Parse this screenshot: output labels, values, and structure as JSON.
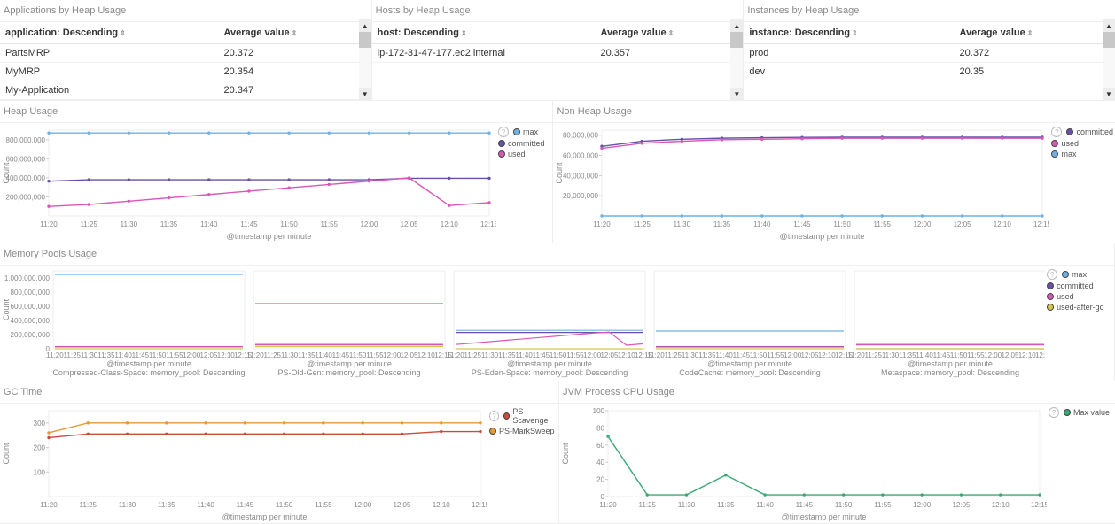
{
  "tables": {
    "apps": {
      "title": "Applications by Heap Usage",
      "col0": "application: Descending",
      "col1": "Average value",
      "rows": [
        {
          "name": "PartsMRP",
          "value": "20.372"
        },
        {
          "name": "MyMRP",
          "value": "20.354"
        },
        {
          "name": "My-Application",
          "value": "20.347"
        }
      ]
    },
    "hosts": {
      "title": "Hosts by Heap Usage",
      "col0": "host: Descending",
      "col1": "Average value",
      "rows": [
        {
          "name": "ip-172-31-47-177.ec2.internal",
          "value": "20.357"
        }
      ]
    },
    "instances": {
      "title": "Instances by Heap Usage",
      "col0": "instance: Descending",
      "col1": "Average value",
      "rows": [
        {
          "name": "prod",
          "value": "20.372"
        },
        {
          "name": "dev",
          "value": "20.35"
        }
      ]
    }
  },
  "charts": {
    "heap": {
      "title": "Heap Usage",
      "xlabel": "@timestamp per minute",
      "ylabel": "Count",
      "legend": [
        "max",
        "committed",
        "used"
      ],
      "colors": [
        "#6fb1e4",
        "#6a4fa8",
        "#d957b6"
      ]
    },
    "nonheap": {
      "title": "Non Heap Usage",
      "xlabel": "@timestamp per minute",
      "ylabel": "Count",
      "legend": [
        "committed",
        "used",
        "max"
      ],
      "colors": [
        "#6a4fa8",
        "#d957b6",
        "#6fb1e4"
      ]
    },
    "mempools": {
      "title": "Memory Pools Usage",
      "xlabel": "@timestamp per minute",
      "ylabel": "Count",
      "legend": [
        "max",
        "committed",
        "used",
        "used-after-gc"
      ],
      "colors": [
        "#6fb1e4",
        "#6a4fa8",
        "#d957b6",
        "#d6c64a"
      ],
      "subs": [
        "Compressed-Class-Space: memory_pool: Descending",
        "PS-Old-Gen: memory_pool: Descending",
        "PS-Eden-Space: memory_pool: Descending",
        "CodeCache: memory_pool: Descending",
        "Metaspace: memory_pool: Descending"
      ]
    },
    "gctime": {
      "title": "GC Time",
      "xlabel": "@timestamp per minute",
      "ylabel": "Count",
      "legend": [
        "PS-Scavenge",
        "PS-MarkSweep"
      ],
      "colors": [
        "#c94d3d",
        "#e49a3a"
      ]
    },
    "cpu": {
      "title": "JVM Process CPU Usage",
      "xlabel": "@timestamp per minute",
      "ylabel": "Count",
      "legend": [
        "Max value"
      ],
      "colors": [
        "#3aa873"
      ]
    },
    "xticks": [
      "11:20",
      "11:25",
      "11:30",
      "11:35",
      "11:40",
      "11:45",
      "11:50",
      "11:55",
      "12:00",
      "12:05",
      "12:10",
      "12:15"
    ]
  },
  "chart_data": [
    {
      "id": "heap",
      "type": "line",
      "title": "Heap Usage",
      "xlabel": "@timestamp per minute",
      "ylabel": "Count",
      "x": [
        "11:20",
        "11:25",
        "11:30",
        "11:35",
        "11:40",
        "11:45",
        "11:50",
        "11:55",
        "12:00",
        "12:05",
        "12:10",
        "12:15"
      ],
      "ylim": [
        0,
        900000000
      ],
      "y_ticks": [
        200000000,
        400000000,
        600000000,
        800000000
      ],
      "series": [
        {
          "name": "max",
          "values": [
            870000000,
            870000000,
            870000000,
            870000000,
            870000000,
            870000000,
            870000000,
            870000000,
            870000000,
            870000000,
            870000000,
            870000000
          ]
        },
        {
          "name": "committed",
          "values": [
            365000000,
            380000000,
            380000000,
            380000000,
            380000000,
            380000000,
            380000000,
            380000000,
            380000000,
            395000000,
            395000000,
            395000000
          ]
        },
        {
          "name": "used",
          "values": [
            100000000,
            120000000,
            155000000,
            190000000,
            225000000,
            260000000,
            295000000,
            330000000,
            365000000,
            400000000,
            110000000,
            140000000
          ]
        }
      ]
    },
    {
      "id": "nonheap",
      "type": "line",
      "title": "Non Heap Usage",
      "xlabel": "@timestamp per minute",
      "ylabel": "Count",
      "x": [
        "11:20",
        "11:25",
        "11:30",
        "11:35",
        "11:40",
        "11:45",
        "11:50",
        "11:55",
        "12:00",
        "12:05",
        "12:10",
        "12:15"
      ],
      "ylim": [
        0,
        85000000
      ],
      "y_ticks": [
        20000000,
        40000000,
        60000000,
        80000000
      ],
      "series": [
        {
          "name": "committed",
          "values": [
            69000000,
            74000000,
            76000000,
            77000000,
            77500000,
            77800000,
            78000000,
            78000000,
            78000000,
            78000000,
            78000000,
            78000000
          ]
        },
        {
          "name": "used",
          "values": [
            67000000,
            72000000,
            74000000,
            75500000,
            76000000,
            76500000,
            77000000,
            77000000,
            77000000,
            77000000,
            77000000,
            77000000
          ]
        },
        {
          "name": "max",
          "values": [
            0,
            0,
            0,
            0,
            0,
            0,
            0,
            0,
            0,
            0,
            0,
            0
          ]
        }
      ]
    },
    {
      "id": "mempools",
      "type": "line",
      "title": "Memory Pools Usage",
      "xlabel": "@timestamp per minute",
      "ylabel": "Count",
      "x": [
        "11:20",
        "11:25",
        "11:30",
        "11:35",
        "11:40",
        "11:45",
        "11:50",
        "11:55",
        "12:00",
        "12:05",
        "12:10",
        "12:15"
      ],
      "ylim": [
        0,
        1100000000
      ],
      "y_ticks": [
        0,
        200000000,
        400000000,
        600000000,
        800000000,
        1000000000
      ],
      "panels": [
        {
          "sub": "Compressed-Class-Space: memory_pool: Descending",
          "series": [
            {
              "name": "max",
              "values": [
                1050000000,
                1050000000,
                1050000000,
                1050000000,
                1050000000,
                1050000000,
                1050000000,
                1050000000,
                1050000000,
                1050000000,
                1050000000,
                1050000000
              ]
            },
            {
              "name": "committed",
              "values": [
                30000000,
                30000000,
                30000000,
                30000000,
                30000000,
                30000000,
                30000000,
                30000000,
                30000000,
                30000000,
                30000000,
                30000000
              ]
            },
            {
              "name": "used",
              "values": [
                28000000,
                28000000,
                28000000,
                28000000,
                28000000,
                28000000,
                28000000,
                28000000,
                28000000,
                28000000,
                28000000,
                28000000
              ]
            },
            {
              "name": "used-after-gc",
              "values": [
                0,
                0,
                0,
                0,
                0,
                0,
                0,
                0,
                0,
                0,
                0,
                0
              ]
            }
          ]
        },
        {
          "sub": "PS-Old-Gen: memory_pool: Descending",
          "series": [
            {
              "name": "max",
              "values": [
                640000000,
                640000000,
                640000000,
                640000000,
                640000000,
                640000000,
                640000000,
                640000000,
                640000000,
                640000000,
                640000000,
                640000000
              ]
            },
            {
              "name": "committed",
              "values": [
                60000000,
                60000000,
                60000000,
                60000000,
                60000000,
                60000000,
                60000000,
                60000000,
                60000000,
                60000000,
                60000000,
                60000000
              ]
            },
            {
              "name": "used",
              "values": [
                55000000,
                55000000,
                55000000,
                55000000,
                55000000,
                55000000,
                55000000,
                55000000,
                55000000,
                55000000,
                55000000,
                55000000
              ]
            },
            {
              "name": "used-after-gc",
              "values": [
                30000000,
                30000000,
                30000000,
                30000000,
                30000000,
                30000000,
                30000000,
                30000000,
                30000000,
                30000000,
                30000000,
                30000000
              ]
            }
          ]
        },
        {
          "sub": "PS-Eden-Space: memory_pool: Descending",
          "series": [
            {
              "name": "max",
              "values": [
                260000000,
                260000000,
                260000000,
                260000000,
                260000000,
                260000000,
                260000000,
                260000000,
                260000000,
                260000000,
                260000000,
                260000000
              ]
            },
            {
              "name": "committed",
              "values": [
                230000000,
                230000000,
                230000000,
                230000000,
                230000000,
                230000000,
                230000000,
                230000000,
                230000000,
                230000000,
                230000000,
                230000000
              ]
            },
            {
              "name": "used",
              "values": [
                60000000,
                80000000,
                100000000,
                120000000,
                140000000,
                160000000,
                180000000,
                200000000,
                220000000,
                235000000,
                50000000,
                70000000
              ]
            },
            {
              "name": "used-after-gc",
              "values": [
                0,
                0,
                0,
                0,
                0,
                0,
                0,
                0,
                0,
                0,
                0,
                0
              ]
            }
          ]
        },
        {
          "sub": "CodeCache: memory_pool: Descending",
          "series": [
            {
              "name": "max",
              "values": [
                250000000,
                250000000,
                250000000,
                250000000,
                250000000,
                250000000,
                250000000,
                250000000,
                250000000,
                250000000,
                250000000,
                250000000
              ]
            },
            {
              "name": "committed",
              "values": [
                30000000,
                30000000,
                30000000,
                30000000,
                30000000,
                30000000,
                30000000,
                30000000,
                30000000,
                30000000,
                30000000,
                30000000
              ]
            },
            {
              "name": "used",
              "values": [
                25000000,
                25000000,
                25000000,
                25000000,
                25000000,
                25000000,
                25000000,
                25000000,
                25000000,
                25000000,
                25000000,
                25000000
              ]
            },
            {
              "name": "used-after-gc",
              "values": [
                0,
                0,
                0,
                0,
                0,
                0,
                0,
                0,
                0,
                0,
                0,
                0
              ]
            }
          ]
        },
        {
          "sub": "Metaspace: memory_pool: Descending",
          "series": [
            {
              "name": "committed",
              "values": [
                60000000,
                60000000,
                60000000,
                60000000,
                60000000,
                60000000,
                60000000,
                60000000,
                60000000,
                60000000,
                60000000,
                60000000
              ]
            },
            {
              "name": "used",
              "values": [
                55000000,
                55000000,
                55000000,
                55000000,
                55000000,
                55000000,
                55000000,
                55000000,
                55000000,
                55000000,
                55000000,
                55000000
              ]
            },
            {
              "name": "max",
              "values": [
                0,
                0,
                0,
                0,
                0,
                0,
                0,
                0,
                0,
                0,
                0,
                0
              ]
            },
            {
              "name": "used-after-gc",
              "values": [
                0,
                0,
                0,
                0,
                0,
                0,
                0,
                0,
                0,
                0,
                0,
                0
              ]
            }
          ]
        }
      ]
    },
    {
      "id": "gctime",
      "type": "line",
      "title": "GC Time",
      "xlabel": "@timestamp per minute",
      "ylabel": "Count",
      "x": [
        "11:20",
        "11:25",
        "11:30",
        "11:35",
        "11:40",
        "11:45",
        "11:50",
        "11:55",
        "12:00",
        "12:05",
        "12:10",
        "12:15"
      ],
      "ylim": [
        0,
        350
      ],
      "y_ticks": [
        100,
        200,
        300
      ],
      "series": [
        {
          "name": "PS-Scavenge",
          "values": [
            240,
            255,
            255,
            255,
            255,
            255,
            255,
            255,
            255,
            255,
            265,
            265
          ]
        },
        {
          "name": "PS-MarkSweep",
          "values": [
            260,
            300,
            300,
            300,
            300,
            300,
            300,
            300,
            300,
            300,
            300,
            300
          ]
        }
      ]
    },
    {
      "id": "cpu",
      "type": "line",
      "title": "JVM Process CPU Usage",
      "xlabel": "@timestamp per minute",
      "ylabel": "Count",
      "x": [
        "11:20",
        "11:25",
        "11:30",
        "11:35",
        "11:40",
        "11:45",
        "11:50",
        "11:55",
        "12:00",
        "12:05",
        "12:10",
        "12:15"
      ],
      "ylim": [
        0,
        100
      ],
      "y_ticks": [
        0,
        20,
        40,
        60,
        80,
        100
      ],
      "series": [
        {
          "name": "Max value",
          "values": [
            70,
            2,
            2,
            25,
            2,
            2,
            2,
            2,
            2,
            2,
            2,
            2
          ]
        }
      ]
    }
  ]
}
